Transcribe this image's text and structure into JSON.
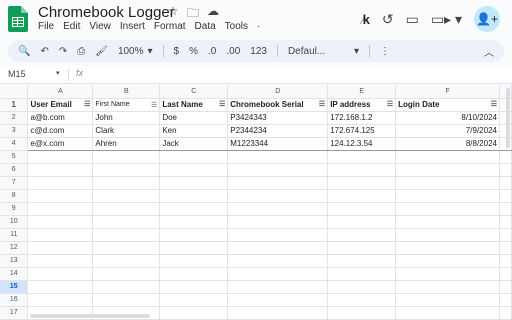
{
  "app": {
    "title": "Chromebook Logger",
    "menu": [
      "File",
      "Edit",
      "View",
      "Insert",
      "Format",
      "Data",
      "Tools",
      "·"
    ],
    "zoom": "100%",
    "font": "Defaul...",
    "toolbar_icons": [
      "search-icon",
      "undo-icon",
      "redo-icon",
      "print-icon",
      "paint-format-icon"
    ],
    "currency": "$",
    "percent": "%",
    "dec_down": ".0",
    "dec_up": ".00",
    "format_123": "123",
    "name_box": "M15",
    "fx": "fx",
    "ext_k": "k",
    "accent": "#0b57d0",
    "logo_color": "#0f9d58"
  },
  "sheet": {
    "columns": [
      "A",
      "B",
      "C",
      "D",
      "E",
      "F"
    ],
    "row_numbers": [
      "1",
      "2",
      "3",
      "4",
      "5",
      "6",
      "7",
      "8",
      "9",
      "10",
      "11",
      "12",
      "13",
      "14",
      "15",
      "16",
      "17"
    ],
    "selected_row": "15",
    "headers": [
      "User Email",
      "First Name",
      "Last Name",
      "Chromebook Serial",
      "IP address",
      "Login Date"
    ],
    "rows": [
      [
        "a@b.com",
        "John",
        "Doe",
        "P3424343",
        "172.168.1.2",
        "8/10/2024"
      ],
      [
        "c@d.com",
        "Clark",
        "Ken",
        "P2344234",
        "172.674.125",
        "7/9/2024"
      ],
      [
        "e@x.com",
        "Ahren",
        "Jack",
        "M1223344",
        "124.12.3.54",
        "8/8/2024"
      ]
    ]
  }
}
